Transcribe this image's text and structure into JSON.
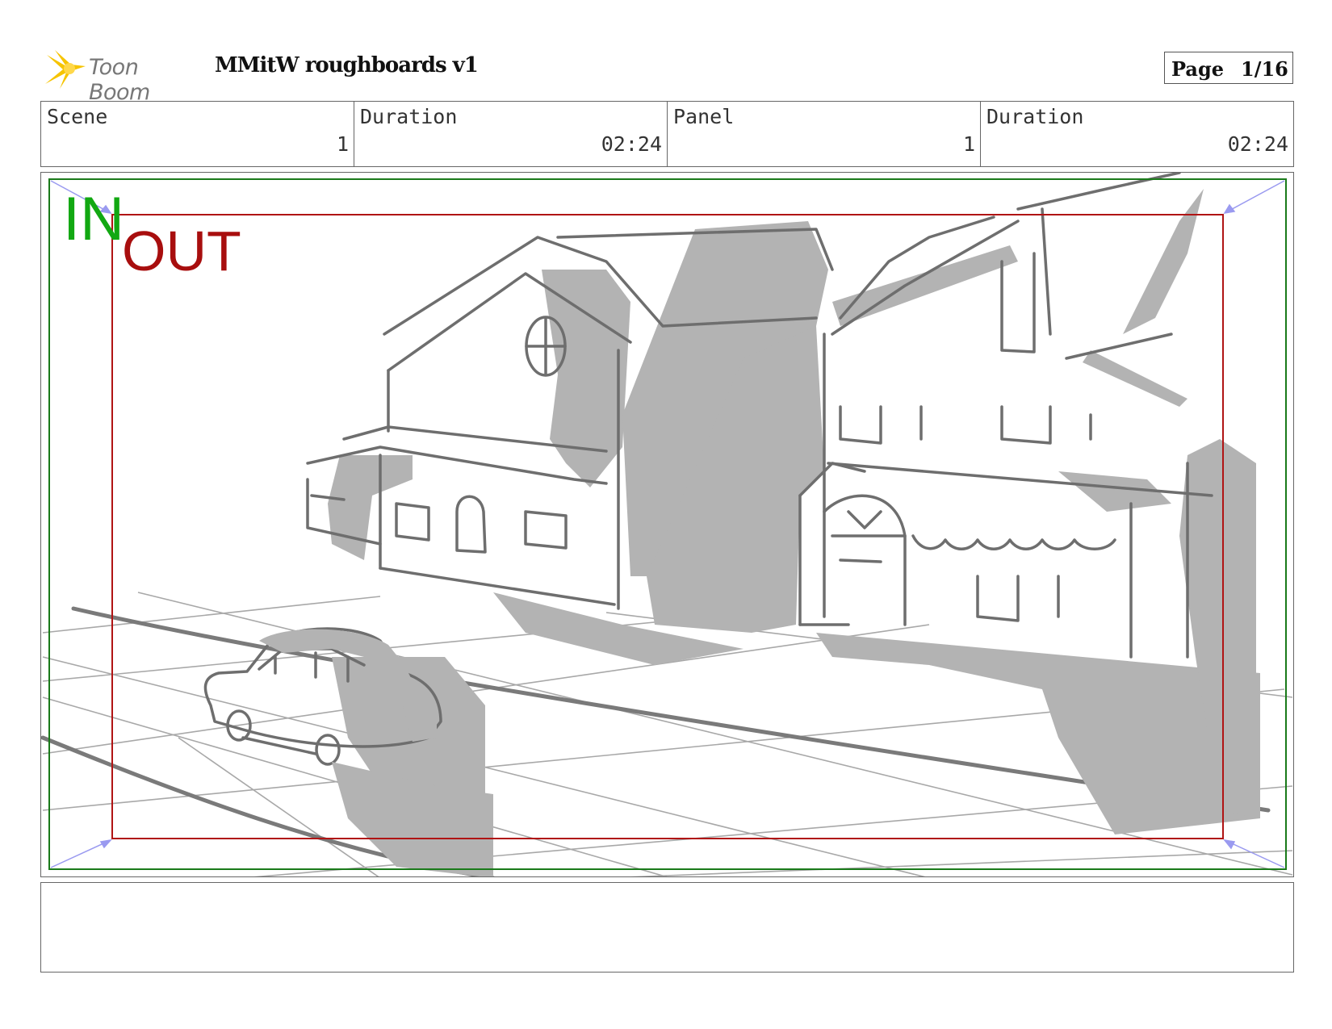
{
  "header": {
    "logo_text": "Toon Boom",
    "project_title": "MMitW roughboards v1",
    "page_label": "Page",
    "page_number": "1/16"
  },
  "info": {
    "scene_label": "Scene",
    "scene_value": "1",
    "scene_duration_label": "Duration",
    "scene_duration_value": "02:24",
    "panel_label": "Panel",
    "panel_value": "1",
    "panel_duration_label": "Duration",
    "panel_duration_value": "02:24"
  },
  "panel": {
    "in_label": "IN",
    "out_label": "OUT",
    "in_frame_color": "#1a7a1a",
    "out_frame_color": "#b01414"
  },
  "notes": {
    "text": ""
  }
}
